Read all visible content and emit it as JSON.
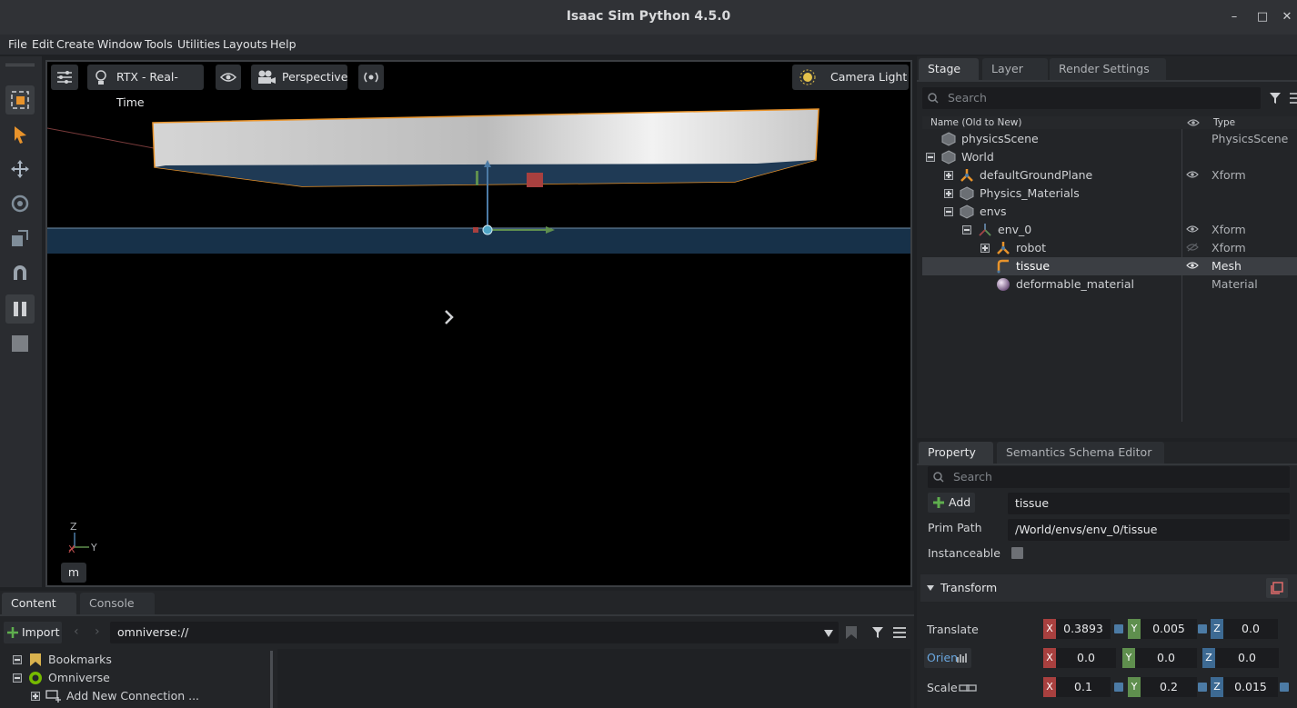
{
  "window": {
    "title": "Isaac Sim Python 4.5.0"
  },
  "menu": [
    "File",
    "Edit",
    "Create",
    "Window",
    "Tools",
    "Utilities",
    "Layouts",
    "Help"
  ],
  "viewport": {
    "renderer_label": "RTX - Real-Time",
    "camera_label": "Perspective",
    "light_label": "Camera Light",
    "units_label": "m",
    "axis_labels": {
      "z": "Z",
      "x": "X",
      "y": "Y"
    }
  },
  "stage": {
    "tabs": [
      "Stage",
      "Layer",
      "Render Settings"
    ],
    "search_placeholder": "Search",
    "col_name": "Name (Old to New)",
    "col_type": "Type",
    "rows": [
      {
        "name": "physicsScene",
        "type": "PhysicsScene"
      },
      {
        "name": "World",
        "type": ""
      },
      {
        "name": "defaultGroundPlane",
        "type": "Xform"
      },
      {
        "name": "Physics_Materials",
        "type": ""
      },
      {
        "name": "envs",
        "type": ""
      },
      {
        "name": "env_0",
        "type": "Xform"
      },
      {
        "name": "robot",
        "type": "Xform"
      },
      {
        "name": "tissue",
        "type": "Mesh"
      },
      {
        "name": "deformable_material",
        "type": "Material"
      }
    ]
  },
  "property": {
    "tabs": [
      "Property",
      "Semantics Schema Editor"
    ],
    "search_placeholder": "Search",
    "add_label": "Add",
    "prim_name": "tissue",
    "prim_path_label": "Prim Path",
    "prim_path": "/World/envs/env_0/tissue",
    "instanceable_label": "Instanceable",
    "transform_label": "Transform",
    "translate_label": "Translate",
    "orient_label": "Orien",
    "scale_label": "Scale",
    "translate": {
      "x": "0.3893",
      "y": "0.005",
      "z": "0.0"
    },
    "orient": {
      "x": "0.0",
      "y": "0.0",
      "z": "0.0"
    },
    "scale": {
      "x": "0.1",
      "y": "0.2",
      "z": "0.015"
    }
  },
  "content": {
    "tabs": [
      "Content",
      "Console"
    ],
    "import_label": "Import",
    "path": "omniverse://",
    "tree": [
      "Bookmarks",
      "Omniverse",
      "Add New Connection ..."
    ]
  },
  "colors": {
    "accent": "#4c7ba5",
    "selection_outline": "#e8932b"
  }
}
